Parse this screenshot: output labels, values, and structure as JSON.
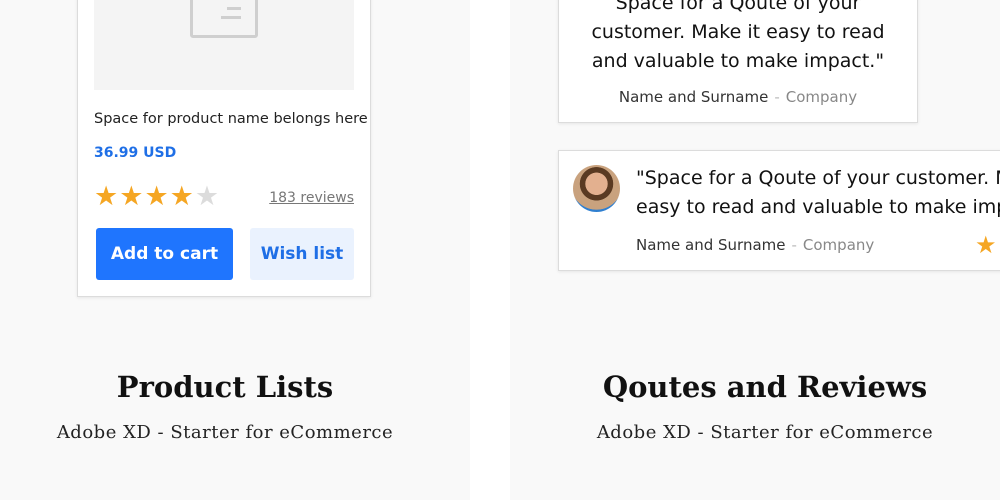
{
  "product_panel": {
    "product_name": "Space for product name belongs here",
    "price": "36.99 USD",
    "rating": 4,
    "rating_max": 5,
    "reviews": "183 reviews",
    "add_to_cart": "Add to cart",
    "wish_list": "Wish list",
    "title": "Product Lists",
    "subtitle": "Adobe XD - Starter for eCommerce",
    "colors": {
      "accent": "#1f75fe",
      "star": "#f5a623"
    }
  },
  "quotes_panel": {
    "quote1": {
      "lines": [
        "Space for a Qoute of your",
        "customer. Make it easy to read",
        "and valuable to make impact.\""
      ],
      "name": "Name and Surname",
      "separator": "-",
      "company": "Company"
    },
    "quote2": {
      "lines": [
        "\"Space for a Qoute of your customer. Make it",
        "easy to read and valuable to make impact.\""
      ],
      "name": "Name and Surname",
      "separator": "-",
      "company": "Company",
      "star": "★"
    },
    "title": "Qoutes and Reviews",
    "subtitle": "Adobe XD - Starter for eCommerce"
  }
}
